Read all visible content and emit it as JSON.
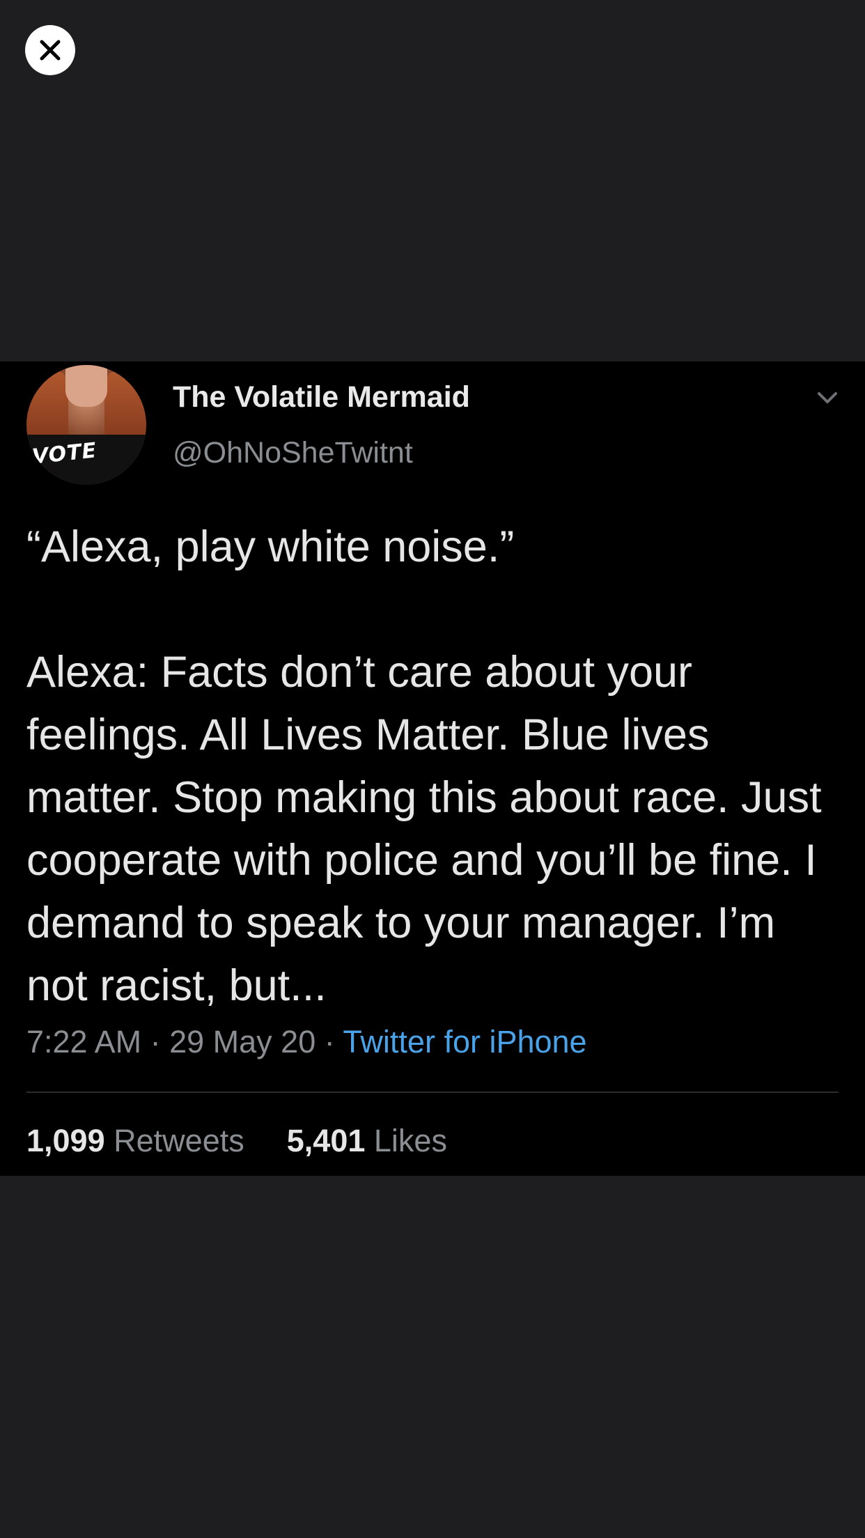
{
  "viewer": {
    "close_icon": "close-icon"
  },
  "tweet": {
    "display_name": "The Volatile Mermaid",
    "handle": "@OhNoSheTwitnt",
    "avatar_text": "VOTE",
    "text_line1": "“Alexa, play white noise.”",
    "text_line2": "Alexa: Facts don’t care about your feelings. All Lives Matter. Blue lives matter. Stop making this about race. Just cooperate with police and you’ll be fine. I demand to speak to your manager. I’m not racist, but...",
    "time": "7:22 AM",
    "date": "29 May 20",
    "separator": " · ",
    "source": "Twitter for iPhone",
    "retweets_count": "1,099",
    "retweets_label": "Retweets",
    "likes_count": "5,401",
    "likes_label": "Likes",
    "menu_icon": "chevron-down-icon"
  },
  "colors": {
    "background": "#1e1e20",
    "tweet_bg": "#000000",
    "link": "#4aa3e8",
    "muted": "#8a8d91"
  }
}
